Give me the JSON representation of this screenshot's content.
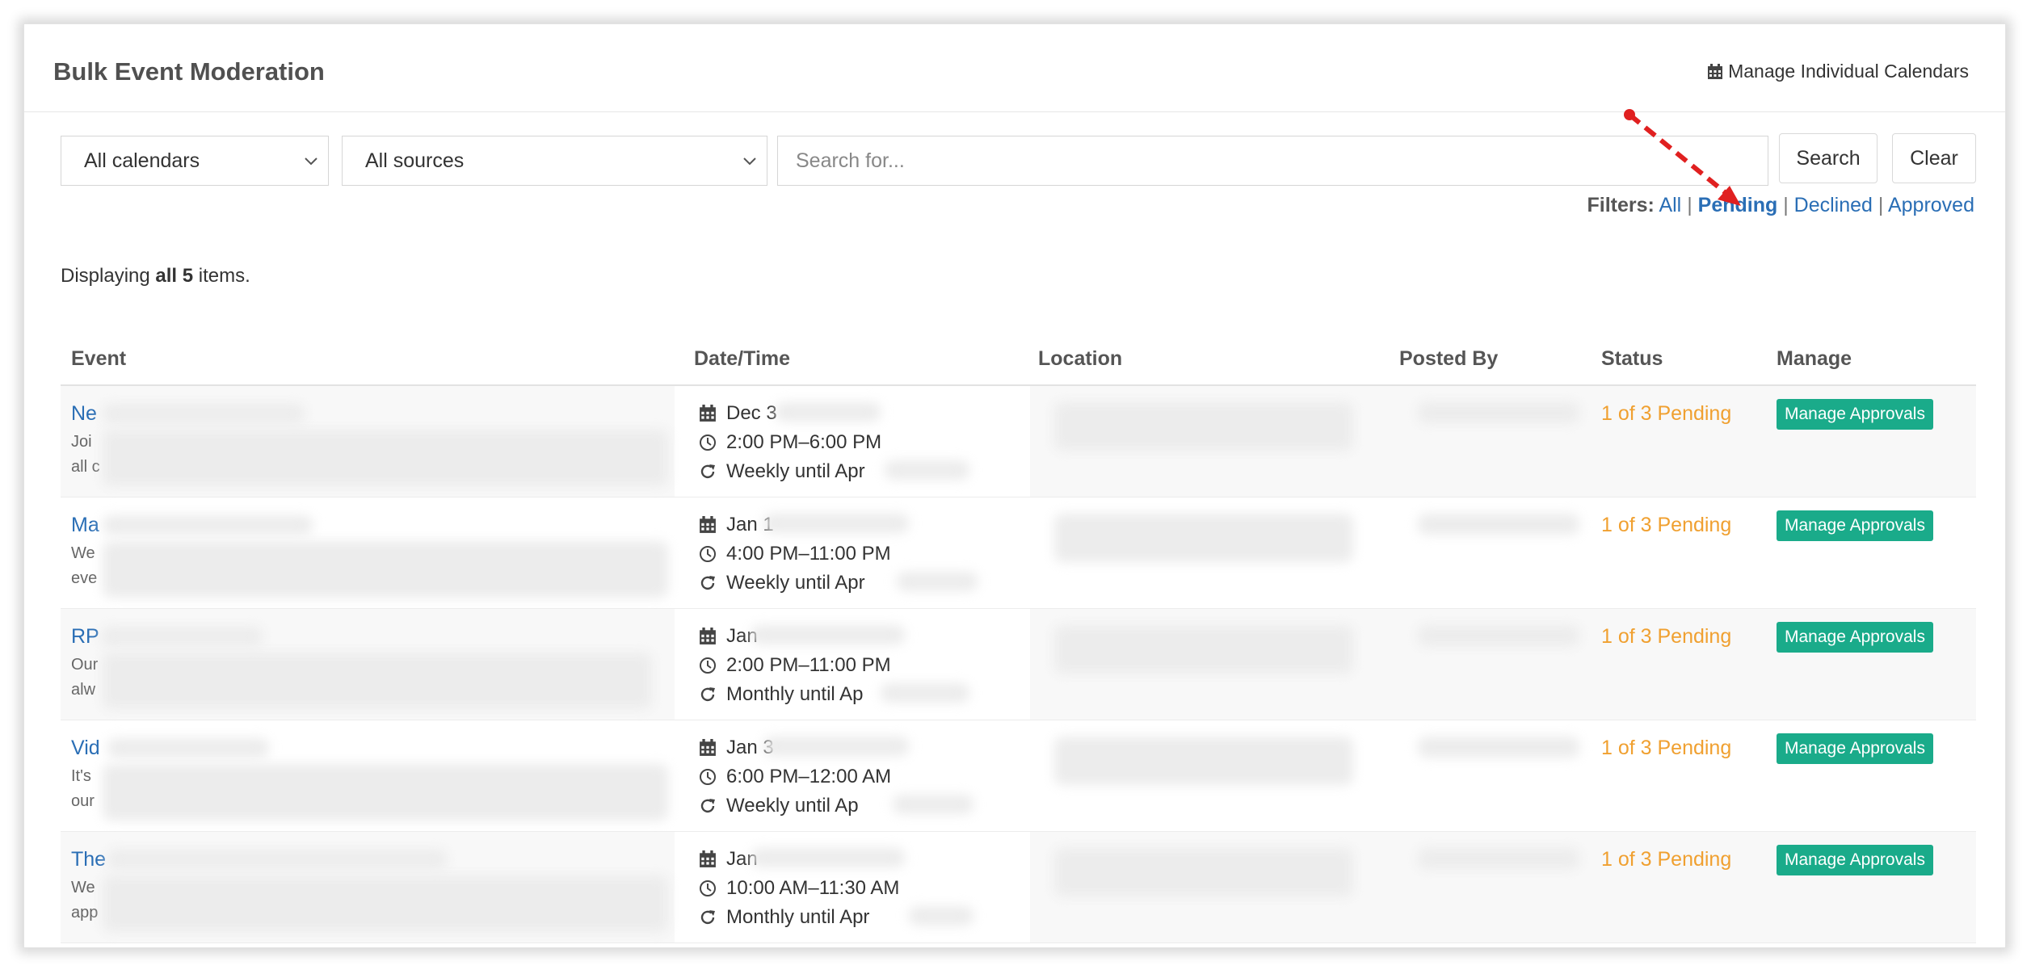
{
  "header": {
    "title": "Bulk Event Moderation",
    "manage_calendars_label": "Manage Individual Calendars"
  },
  "toolbar": {
    "calendar_select": "All calendars",
    "source_select": "All sources",
    "search_placeholder": "Search for...",
    "search_label": "Search",
    "clear_label": "Clear"
  },
  "filters": {
    "label": "Filters:",
    "items": [
      "All",
      "Pending",
      "Declined",
      "Approved"
    ],
    "active": "Pending",
    "separator": "|"
  },
  "display": {
    "prefix": "Displaying ",
    "bold": "all 5",
    "suffix": " items."
  },
  "table": {
    "columns": [
      "Event",
      "Date/Time",
      "Location",
      "Posted By",
      "Status",
      "Manage"
    ],
    "rows": [
      {
        "title": "Ne",
        "desc1": "Joi",
        "desc2": "all c",
        "date": "Dec 3",
        "time": "2:00 PM–6:00 PM",
        "recurrence": "Weekly until Apr",
        "status": "1 of 3 Pending",
        "action": "Manage Approvals"
      },
      {
        "title": "Ma",
        "desc1": "We",
        "desc2": "eve",
        "date": "Jan 1",
        "time": "4:00 PM–11:00 PM",
        "recurrence": "Weekly until Apr",
        "status": "1 of 3 Pending",
        "action": "Manage Approvals"
      },
      {
        "title": "RP",
        "desc1": "Our",
        "desc2": "alw",
        "date": "Jan",
        "time": "2:00 PM–11:00 PM",
        "recurrence": "Monthly until Ap",
        "status": "1 of 3 Pending",
        "action": "Manage Approvals"
      },
      {
        "title": "Vid",
        "desc1": "It's",
        "desc2": "our",
        "date": "Jan 3",
        "time": "6:00 PM–12:00 AM",
        "recurrence": "Weekly until Ap",
        "status": "1 of 3 Pending",
        "action": "Manage Approvals"
      },
      {
        "title": "The",
        "desc1": "We",
        "desc2": "app",
        "date": "Jan",
        "time": "10:00 AM–11:30 AM",
        "recurrence": "Monthly until Apr",
        "status": "1 of 3 Pending",
        "action": "Manage Approvals"
      }
    ]
  },
  "icons": {
    "date": "calendar-icon",
    "time": "clock-icon",
    "recurrence": "redo-icon",
    "manage_calendars": "calendar-icon"
  },
  "colors": {
    "link": "#2a6eb5",
    "status_pending": "#f0a030",
    "action_button": "#1aab8a",
    "annotation_arrow": "#e02020"
  }
}
